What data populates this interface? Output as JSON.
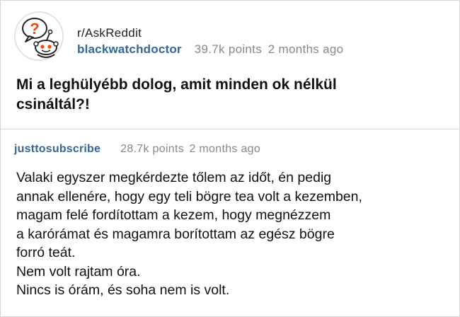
{
  "post": {
    "subreddit": "r/AskReddit",
    "author": "blackwatchdoctor",
    "points": "39.7k points",
    "time": "2 months ago",
    "title_line1": "Mi a leghülyébb dolog, amit minden ok nélkül",
    "title_line2": "csináltál?!",
    "avatar_glyph": "?",
    "icon": "askreddit-snoo-icon",
    "accent_color": "#336699"
  },
  "comment": {
    "author": "justtosubscribe",
    "points": "28.7k points",
    "time": "2 months ago",
    "lines": [
      "Valaki egyszer megkérdezte tőlem az időt, én pedig",
      "annak ellenére, hogy egy teli bögre tea volt a kezemben,",
      "magam felé fordítottam a kezem, hogy megnézzem",
      "a karórámat és magamra borítottam az egész bögre",
      "forró teát.",
      "Nem volt rajtam óra.",
      "Nincs is órám, és soha nem is volt."
    ]
  }
}
